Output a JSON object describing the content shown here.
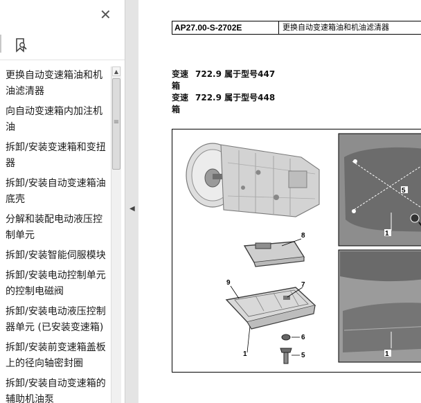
{
  "sidebar": {
    "close_glyph": "✕",
    "bookmarks": [
      "更换自动变速箱油和机油滤清器",
      "向自动变速箱内加注机油",
      "拆卸/安装变速箱和变扭器",
      "拆卸/安装自动变速箱油底壳",
      "分解和装配电动液压控制单元",
      "拆卸/安装智能伺服模块",
      "拆卸/安装电动控制单元的控制电磁阀",
      "拆卸/安装电动液压控制器单元 (已安装变速箱)",
      "拆卸/安装前变速箱盖板上的径向轴密封圈",
      "拆卸/安装自动变速箱的辅助机油泵"
    ],
    "scroll_up_glyph": "▲",
    "scroll_grip_glyph": "≡"
  },
  "splitter": {
    "arrow_glyph": "◀"
  },
  "document": {
    "code": "AP27.00-S-2702E",
    "title": "更换自动变速箱油和机油滤清器",
    "specs": [
      {
        "label": "变速箱",
        "value": "722.9 属于型号447"
      },
      {
        "label": "变速箱",
        "value": "722.9 属于型号448"
      }
    ],
    "figure": {
      "callouts": {
        "filter": "8",
        "gasket": "9",
        "magnet": "7",
        "seal": "6",
        "screw": "5",
        "pan": "1"
      },
      "photo_top_callouts": {
        "screws": "5",
        "pan": "1"
      },
      "photo_bottom_callouts": {
        "pan": "1"
      }
    }
  }
}
